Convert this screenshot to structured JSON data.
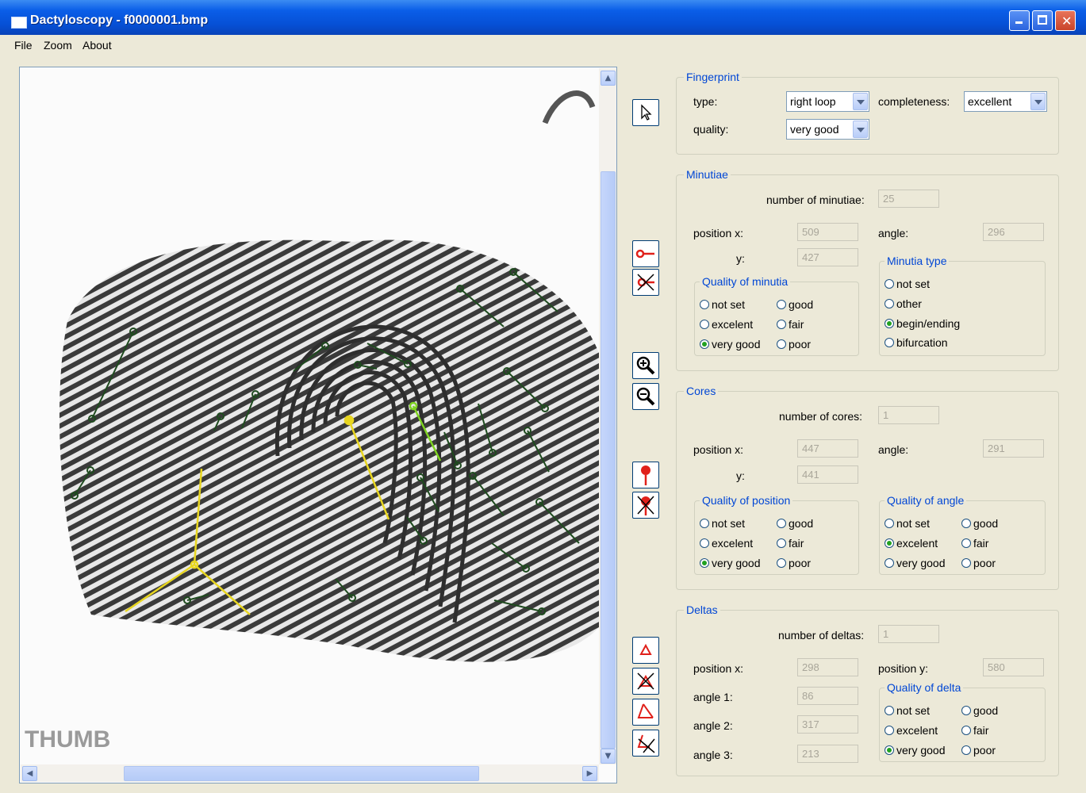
{
  "window": {
    "title": "Dactyloscopy - f0000001.bmp"
  },
  "menu": [
    "File",
    "Zoom",
    "About"
  ],
  "image": {
    "caption": "THUMB"
  },
  "fingerprint": {
    "label": "Fingerprint",
    "type_label": "type:",
    "type_value": "right loop",
    "completeness_label": "completeness:",
    "completeness_value": "excellent",
    "quality_label": "quality:",
    "quality_value": "very good"
  },
  "minutiae": {
    "label": "Minutiae",
    "count_label": "number of minutiae:",
    "count": "25",
    "pos_x_label": "position x:",
    "pos_x": "509",
    "pos_y_label": "y:",
    "pos_y": "427",
    "angle_label": "angle:",
    "angle": "296",
    "quality_title": "Quality of minutia",
    "quality_options": [
      "not set",
      "good",
      "excelent",
      "fair",
      "very good",
      "poor"
    ],
    "quality_selected": "very good",
    "type_title": "Minutia type",
    "type_options": [
      "not set",
      "other",
      "begin/ending",
      "bifurcation"
    ],
    "type_selected": "begin/ending"
  },
  "cores": {
    "label": "Cores",
    "count_label": "number of cores:",
    "count": "1",
    "pos_x_label": "position x:",
    "pos_x": "447",
    "pos_y_label": "y:",
    "pos_y": "441",
    "angle_label": "angle:",
    "angle": "291",
    "pos_quality_title": "Quality of position",
    "pos_quality_options": [
      "not set",
      "good",
      "excelent",
      "fair",
      "very good",
      "poor"
    ],
    "pos_quality_selected": "very good",
    "angle_quality_title": "Quality of angle",
    "angle_quality_options": [
      "not set",
      "good",
      "excelent",
      "fair",
      "very good",
      "poor"
    ],
    "angle_quality_selected": "excelent"
  },
  "deltas": {
    "label": "Deltas",
    "count_label": "number of deltas:",
    "count": "1",
    "pos_x_label": "position x:",
    "pos_x": "298",
    "pos_y_label": "position y:",
    "pos_y": "580",
    "angle1_label": "angle 1:",
    "angle1": "86",
    "angle2_label": "angle 2:",
    "angle2": "317",
    "angle3_label": "angle 3:",
    "angle3": "213",
    "quality_title": "Quality of delta",
    "quality_options": [
      "not set",
      "good",
      "excelent",
      "fair",
      "very good",
      "poor"
    ],
    "quality_selected": "very good"
  },
  "colors": {
    "minutia": "#1e4a1e",
    "selected": "#7ed321",
    "core": "#e8d620",
    "tool_red": "#e0201a"
  }
}
